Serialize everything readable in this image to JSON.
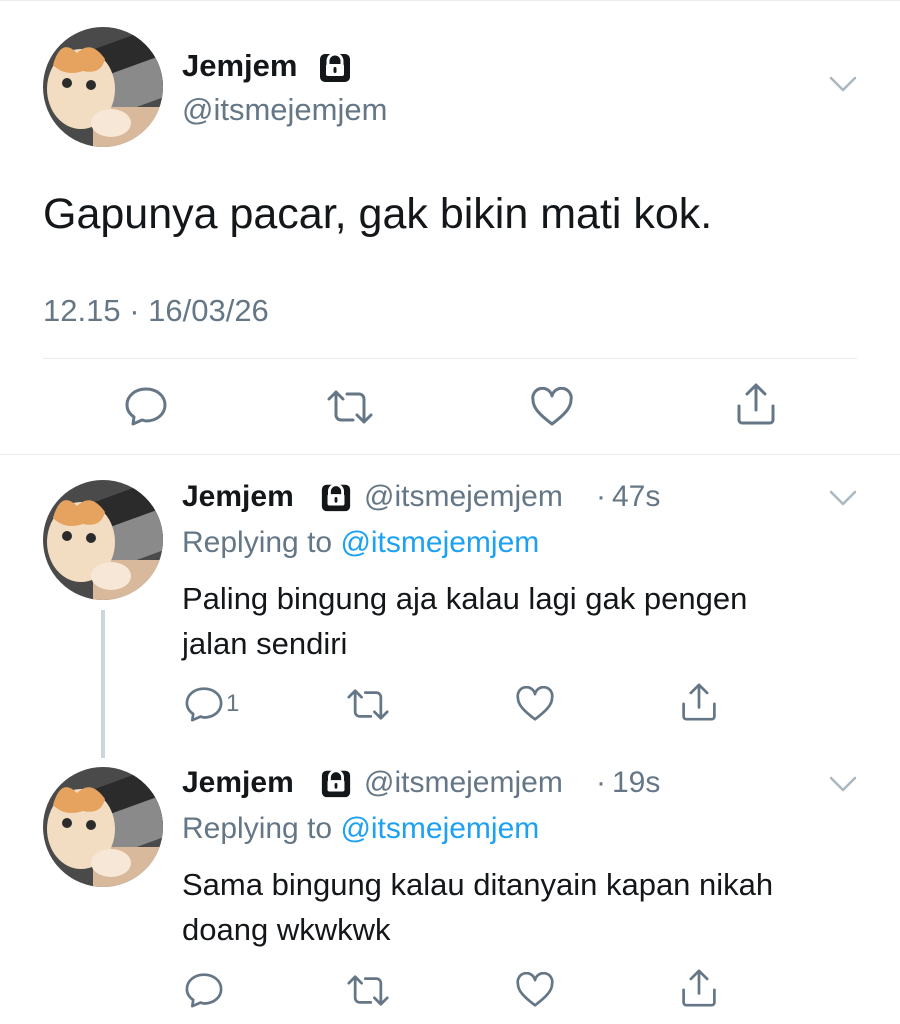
{
  "main_tweet": {
    "author_name": "Jemjem",
    "author_handle": "@itsmejemjem",
    "protected_icon": "lock-icon",
    "text": "Gapunya pacar, gak bikin mati kok.",
    "timestamp": "12.15 · 16/03/26",
    "actions": [
      "reply-icon",
      "retweet-icon",
      "like-icon",
      "share-icon"
    ]
  },
  "replies": [
    {
      "author_name": "Jemjem",
      "author_handle": "@itsmejemjem",
      "separator": "·",
      "time_ago": "47s",
      "replying_prefix": "Replying to ",
      "replying_to": "@itsmejemjem",
      "text_line1": "Paling bingung aja kalau lagi gak pengen",
      "text_line2": "jalan sendiri",
      "reply_count": "1"
    },
    {
      "author_name": "Jemjem",
      "author_handle": "@itsmejemjem",
      "separator": "·",
      "time_ago": "19s",
      "replying_prefix": "Replying to ",
      "replying_to": "@itsmejemjem",
      "text_line1": "Sama bingung kalau ditanyain kapan nikah",
      "text_line2": "doang wkwkwk",
      "reply_count": ""
    }
  ],
  "colors": {
    "text": "#14171a",
    "secondary": "#657786",
    "link": "#1da1f2",
    "divider": "#e6ecf0",
    "thread_line": "#ccd6dd"
  }
}
